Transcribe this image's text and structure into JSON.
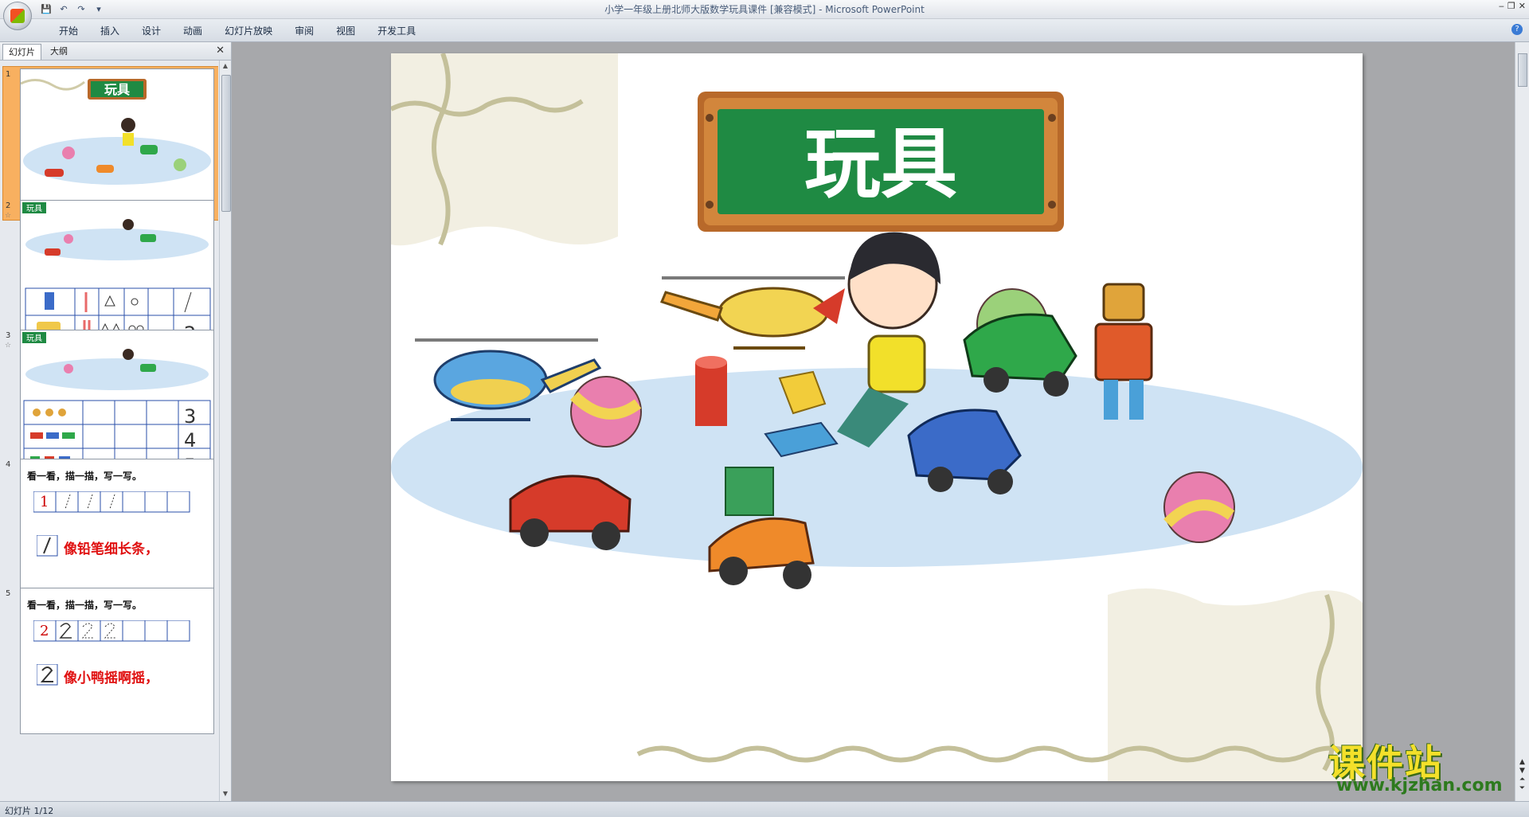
{
  "window": {
    "title": "小学一年级上册北师大版数学玩具课件 [兼容模式] - Microsoft PowerPoint"
  },
  "ribbon": {
    "tabs": [
      "开始",
      "插入",
      "设计",
      "动画",
      "幻灯片放映",
      "审阅",
      "视图",
      "开发工具"
    ]
  },
  "left_pane": {
    "tabs": [
      "幻灯片",
      "大纲"
    ],
    "active_tab": "幻灯片",
    "thumbnails": [
      {
        "number": "1",
        "selected": true,
        "title": "玩具"
      },
      {
        "number": "2",
        "title": "玩具",
        "star": "☆"
      },
      {
        "number": "3",
        "title": "玩具",
        "star": "☆"
      },
      {
        "number": "4",
        "heading": "看一看，描一描，写一写。",
        "digit": "1",
        "caption": "像铅笔细长条，"
      },
      {
        "number": "5",
        "heading": "看一看，描一描，写一写。",
        "digit": "2",
        "caption": "像小鸭摇啊摇，"
      }
    ]
  },
  "slide": {
    "title": "玩具"
  },
  "status_bar": {
    "text": "幻灯片 1/12"
  },
  "watermark": {
    "line1": "课件站",
    "line2": "www.kjzhan.com"
  },
  "colors": {
    "sign_green": "#1f8a43",
    "sign_frame": "#b8692a",
    "mat_blue": "#cfe3f4",
    "selected_thumb": "#f8b060"
  }
}
